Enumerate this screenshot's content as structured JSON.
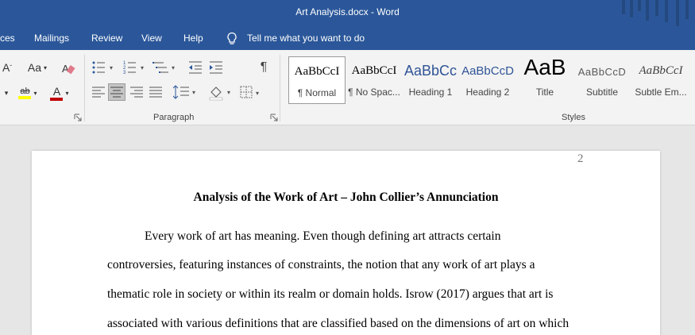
{
  "window": {
    "title": "Art Analysis.docx  -  Word"
  },
  "menu": {
    "tabs": [
      "ces",
      "Mailings",
      "Review",
      "View",
      "Help"
    ],
    "tell_me": "Tell me what you want to do"
  },
  "ribbon": {
    "font_group": {
      "change_case": "Aa",
      "highlight": "ab"
    },
    "paragraph_group": {
      "label": "Paragraph"
    },
    "styles_group": {
      "label": "Styles",
      "items": [
        {
          "preview": "AaBbCcI",
          "name": "¶ Normal",
          "selected": true
        },
        {
          "preview": "AaBbCcI",
          "name": "¶ No Spac..."
        },
        {
          "preview": "AaBbCc",
          "name": "Heading 1"
        },
        {
          "preview": "AaBbCcD",
          "name": "Heading 2"
        },
        {
          "preview": "AaB",
          "name": "Title"
        },
        {
          "preview": "AaBbCcD",
          "name": "Subtitle"
        },
        {
          "preview": "AaBbCcI",
          "name": "Subtle Em..."
        }
      ]
    }
  },
  "document": {
    "page_number": "2",
    "title": "Analysis of the Work of Art – John Collier’s Annunciation",
    "lines": [
      "Every work of art has meaning. Even though defining art attracts certain",
      "controversies, featuring instances of constraints, the notion that any work of art plays a",
      "thematic role in society or within its realm or domain holds. Isrow (2017) argues that art is",
      "associated with various definitions that are classified based on the dimensions of art on which"
    ]
  },
  "colors": {
    "word_blue": "#2b579a",
    "ribbon_bg": "#f3f3f3",
    "canvas_bg": "#e6e6e6",
    "font_red": "#c00000",
    "highlight_yellow": "#ffff00"
  }
}
